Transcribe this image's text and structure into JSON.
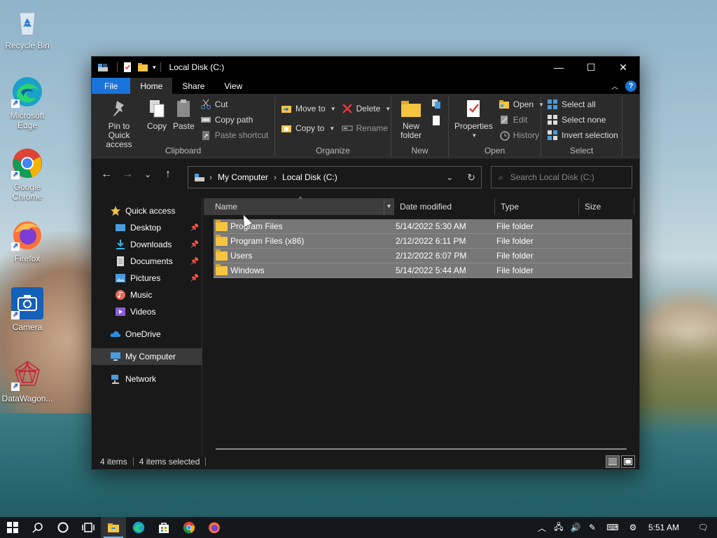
{
  "desktop": {
    "icons": [
      {
        "label": "Recycle Bin",
        "icon": "recycle-bin-icon"
      },
      {
        "label": "Microsoft Edge",
        "icon": "edge-icon"
      },
      {
        "label": "Google Chrome",
        "icon": "chrome-icon"
      },
      {
        "label": "Firefox",
        "icon": "firefox-icon"
      },
      {
        "label": "Camera",
        "icon": "camera-icon"
      },
      {
        "label": "DataWagon...",
        "icon": "datawagon-icon"
      }
    ]
  },
  "window": {
    "title": "Local Disk (C:)",
    "tabs": [
      "File",
      "Home",
      "Share",
      "View"
    ],
    "active_tab": "Home",
    "ribbon": {
      "clipboard": {
        "label": "Clipboard",
        "pin_label": "Pin to Quick access",
        "copy_label": "Copy",
        "paste_label": "Paste",
        "cut_label": "Cut",
        "copy_path_label": "Copy path",
        "paste_shortcut_label": "Paste shortcut"
      },
      "organize": {
        "label": "Organize",
        "move_to_label": "Move to",
        "copy_to_label": "Copy to",
        "delete_label": "Delete",
        "rename_label": "Rename"
      },
      "new": {
        "label": "New",
        "new_folder_label": "New folder"
      },
      "open": {
        "label": "Open",
        "properties_label": "Properties",
        "open_label": "Open",
        "edit_label": "Edit",
        "history_label": "History"
      },
      "select": {
        "label": "Select",
        "select_all_label": "Select all",
        "select_none_label": "Select none",
        "invert_label": "Invert selection"
      }
    },
    "address": {
      "crumbs": [
        "My Computer",
        "Local Disk (C:)"
      ],
      "search_placeholder": "Search Local Disk (C:)"
    },
    "nav": {
      "quick_access": "Quick access",
      "items": [
        {
          "label": "Desktop",
          "pinned": true
        },
        {
          "label": "Downloads",
          "pinned": true
        },
        {
          "label": "Documents",
          "pinned": true
        },
        {
          "label": "Pictures",
          "pinned": true
        },
        {
          "label": "Music",
          "pinned": false
        },
        {
          "label": "Videos",
          "pinned": false
        }
      ],
      "onedrive": "OneDrive",
      "my_computer": "My Computer",
      "network": "Network"
    },
    "columns": [
      "Name",
      "Date modified",
      "Type",
      "Size"
    ],
    "files": [
      {
        "name": "Program Files",
        "date": "5/14/2022 5:30 AM",
        "type": "File folder",
        "size": ""
      },
      {
        "name": "Program Files (x86)",
        "date": "2/12/2022 6:11 PM",
        "type": "File folder",
        "size": ""
      },
      {
        "name": "Users",
        "date": "2/12/2022 6:07 PM",
        "type": "File folder",
        "size": ""
      },
      {
        "name": "Windows",
        "date": "5/14/2022 5:44 AM",
        "type": "File folder",
        "size": ""
      }
    ],
    "status": {
      "items": "4 items",
      "selected": "4 items selected"
    }
  },
  "taskbar": {
    "clock": "5:51 AM"
  },
  "colors": {
    "accent": "#1a73d8",
    "selection": "#777777",
    "folder": "#f5c542"
  }
}
